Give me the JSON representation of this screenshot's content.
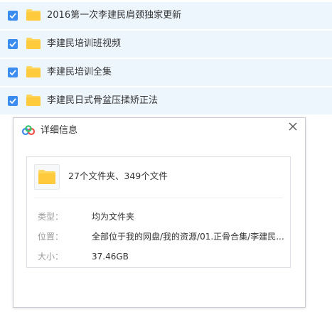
{
  "file_list": {
    "items": [
      {
        "name": "2016第一次李建民肩颈独家更新",
        "checked": true
      },
      {
        "name": "李建民培训班视频",
        "checked": true
      },
      {
        "name": "李建民培训全集",
        "checked": true
      },
      {
        "name": "李建民日式骨盆压揉矫正法",
        "checked": true
      }
    ]
  },
  "dialog": {
    "title": "详细信息",
    "summary": "27个文件夹、349个文件",
    "type_label": "类型：",
    "type_value": "均为文件夹",
    "location_label": "位置：",
    "location_value": "全部位于我的网盘/我的资源/01.正骨合集/李建民...",
    "size_label": "大小：",
    "size_value": "37.46GB"
  },
  "colors": {
    "row_bg": "#eef6fd",
    "checkbox": "#3b8cf0",
    "folder": "#ffd65c"
  },
  "icons": [
    "checkbox-icon",
    "folder-icon",
    "baidu-cloud-logo-icon",
    "close-icon"
  ]
}
